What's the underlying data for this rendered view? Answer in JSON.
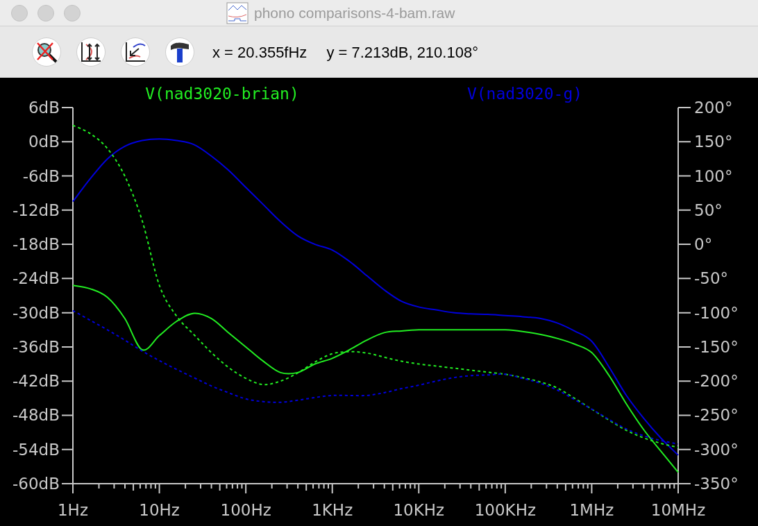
{
  "window": {
    "title": "phono comparisons-4-bam.raw"
  },
  "toolbar": {
    "cursor_x": "x = 20.355fHz",
    "cursor_y": "y = 7.213dB, 210.108°"
  },
  "plot": {
    "chart_data": {
      "type": "line",
      "categories": [
        "1Hz",
        null,
        null,
        null,
        null,
        "10Hz",
        null,
        null,
        null,
        null,
        "100Hz",
        null,
        null,
        null,
        null,
        "1KHz",
        null,
        null,
        null,
        null,
        "10KHz",
        null,
        null,
        null,
        null,
        "100KHz",
        null,
        null,
        null,
        null,
        "1MHz",
        null,
        null,
        null,
        null,
        "10MHz"
      ],
      "ylim": [
        -60,
        6
      ],
      "y2lim": [
        -350,
        200
      ],
      "yticks": [
        {
          "value": 6,
          "label": "6dB"
        },
        {
          "value": 0,
          "label": "0dB"
        },
        {
          "value": -6,
          "label": "-6dB"
        },
        {
          "value": -12,
          "label": "-12dB"
        },
        {
          "value": -18,
          "label": "-18dB"
        },
        {
          "value": -24,
          "label": "-24dB"
        },
        {
          "value": -30,
          "label": "-30dB"
        },
        {
          "value": -36,
          "label": "-36dB"
        },
        {
          "value": -42,
          "label": "-42dB"
        },
        {
          "value": -48,
          "label": "-48dB"
        },
        {
          "value": -54,
          "label": "-54dB"
        },
        {
          "value": -60,
          "label": "-60dB"
        }
      ],
      "y2ticks": [
        {
          "value": 200,
          "label": "200°"
        },
        {
          "value": 150,
          "label": "150°"
        },
        {
          "value": 100,
          "label": "100°"
        },
        {
          "value": 50,
          "label": "50°"
        },
        {
          "value": 0,
          "label": "0°"
        },
        {
          "value": -50,
          "label": "-50°"
        },
        {
          "value": -100,
          "label": "-100°"
        },
        {
          "value": -150,
          "label": "-150°"
        },
        {
          "value": -200,
          "label": "-200°"
        },
        {
          "value": -250,
          "label": "-250°"
        },
        {
          "value": -300,
          "label": "-300°"
        },
        {
          "value": -350,
          "label": "-350°"
        }
      ],
      "series": [
        {
          "name": "V(nad3020-brian)",
          "color": "#22ee22",
          "values": [
            -25.2,
            -25.8,
            -27.3,
            -31,
            -36.5,
            -34,
            -31.5,
            -30.1,
            -31,
            -33.5,
            -36,
            -38.5,
            -40.5,
            -40.5,
            -39,
            -38,
            -36.5,
            -34.8,
            -33.5,
            -33.2,
            -33,
            -33,
            -33,
            -33,
            -33,
            -33,
            -33.3,
            -33.8,
            -34.5,
            -35.5,
            -37,
            -41,
            -46,
            -50.5,
            -54.3,
            -58
          ]
        },
        {
          "name": "V(nad3020-g)",
          "color": "#0000dd",
          "values": [
            -10.5,
            -6.5,
            -3,
            -0.8,
            0.2,
            0.5,
            0.2,
            -0.5,
            -2.5,
            -5,
            -8,
            -11,
            -14,
            -16.5,
            -18,
            -19,
            -21,
            -23.5,
            -26,
            -28,
            -29,
            -29.5,
            -30,
            -30.2,
            -30.3,
            -30.5,
            -30.7,
            -31,
            -31.8,
            -33.2,
            -35,
            -39.5,
            -44.5,
            -48.5,
            -52,
            -55
          ]
        },
        {
          "color": "#22ee22",
          "axis": "y2",
          "line_style": "dashed",
          "values": [
            174,
            162,
            140,
            100,
            35,
            -60,
            -105,
            -132,
            -158,
            -180,
            -196,
            -205,
            -200,
            -188,
            -172,
            -160,
            -157,
            -159,
            -165,
            -171,
            -175,
            -178,
            -181,
            -184,
            -187,
            -190,
            -195,
            -201,
            -210,
            -225,
            -241,
            -257,
            -272,
            -283,
            -291,
            -297
          ]
        },
        {
          "color": "#0000dd",
          "axis": "y2",
          "line_style": "dashed",
          "values": [
            -97,
            -111,
            -125,
            -140,
            -156,
            -170,
            -183,
            -195,
            -207,
            -217,
            -226,
            -230,
            -231,
            -228,
            -224,
            -221,
            -221,
            -221,
            -217,
            -211,
            -206,
            -200,
            -195,
            -192,
            -191,
            -190,
            -196,
            -203,
            -213,
            -227,
            -241,
            -256,
            -270,
            -280,
            -287,
            -292
          ]
        }
      ]
    }
  }
}
